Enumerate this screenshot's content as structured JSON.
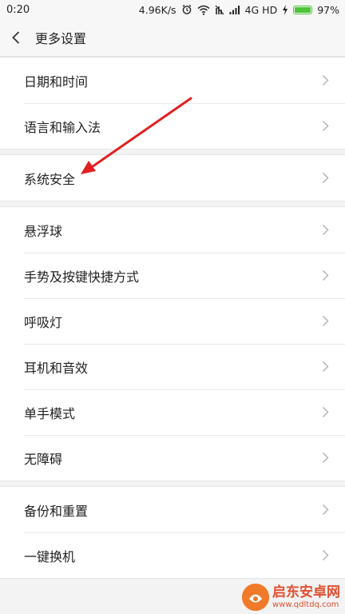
{
  "status_bar": {
    "time": "0:20",
    "speed": "4.96K/s",
    "network": "4G HD",
    "battery": "97%",
    "battery_level": 0.97
  },
  "header": {
    "title": "更多设置"
  },
  "groups": [
    {
      "items": [
        {
          "label": "日期和时间"
        },
        {
          "label": "语言和输入法"
        }
      ]
    },
    {
      "items": [
        {
          "label": "系统安全"
        }
      ]
    },
    {
      "items": [
        {
          "label": "悬浮球"
        },
        {
          "label": "手势及按键快捷方式"
        },
        {
          "label": "呼吸灯"
        },
        {
          "label": "耳机和音效"
        },
        {
          "label": "单手模式"
        },
        {
          "label": "无障碍"
        }
      ]
    },
    {
      "items": [
        {
          "label": "备份和重置"
        },
        {
          "label": "一键换机"
        }
      ]
    }
  ],
  "annotation": {
    "arrow_color": "#e02020"
  },
  "watermark": {
    "name": "启东安卓网",
    "url": "www.qdltdq.com"
  },
  "colors": {
    "accent": "#4fc33a",
    "chevron": "#b5b5b5"
  }
}
